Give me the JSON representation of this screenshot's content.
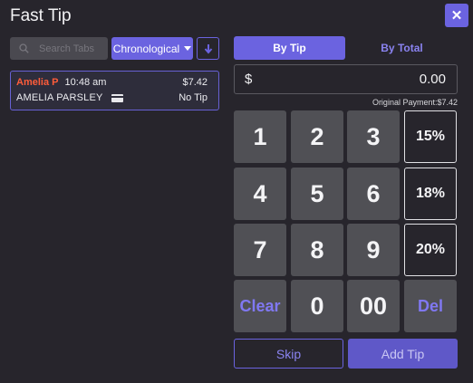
{
  "window": {
    "title": "Fast Tip",
    "close_label": "✕"
  },
  "tabs_panel": {
    "search_placeholder": "Search Tabs",
    "sort_label": "Chronological",
    "tabs": [
      {
        "name": "Amelia P",
        "time": "10:48 am",
        "amount": "$7.42",
        "customer": "AMELIA PARSLEY",
        "tip": "No Tip"
      }
    ]
  },
  "tip_panel": {
    "modes": {
      "by_tip": "By Tip",
      "by_total": "By Total",
      "active": "By Tip"
    },
    "amount": {
      "currency": "$",
      "value": "0.00"
    },
    "original_payment": "Original Payment:$7.42",
    "keys": {
      "k1": "1",
      "k2": "2",
      "k3": "3",
      "k4": "4",
      "k5": "5",
      "k6": "6",
      "k7": "7",
      "k8": "8",
      "k9": "9",
      "k0": "0",
      "k00": "00",
      "clear": "Clear",
      "del": "Del"
    },
    "percent_keys": {
      "p15": "15%",
      "p18": "18%",
      "p20": "20%"
    },
    "skip_label": "Skip",
    "add_tip_label": "Add Tip"
  },
  "colors": {
    "accent": "#6b63e0",
    "background": "#27252c",
    "key": "#505055",
    "tab_name": "#ff5c3a"
  },
  "icons": {
    "search": "search-icon",
    "sort_direction": "arrow-down-icon",
    "card": "credit-card-icon",
    "close": "close-icon"
  }
}
